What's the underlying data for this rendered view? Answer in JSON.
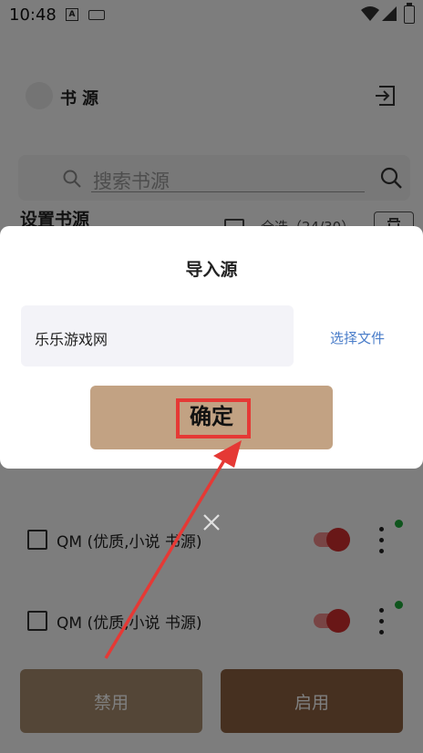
{
  "status_bar": {
    "time": "10:48",
    "notif_letter": "A"
  },
  "app_bar": {
    "title": "书源"
  },
  "search": {
    "placeholder": "搜索书源"
  },
  "section": {
    "title": "设置书源",
    "select_all_label": "全选（24/30）"
  },
  "sources": [
    {
      "name": "QM (优质,小说 书源)",
      "enabled": true,
      "status": "active"
    },
    {
      "name": "QM (优质,小说 书源)",
      "enabled": true,
      "status": "active"
    }
  ],
  "bottom": {
    "disable_label": "禁用",
    "enable_label": "启用"
  },
  "dialog": {
    "title": "导入源",
    "input_value": "乐乐游戏网",
    "choose_file_label": "选择文件",
    "confirm_label": "确定"
  },
  "colors": {
    "confirm_button": "#c2a283",
    "highlight_frame": "#e53935",
    "link_blue": "#4a7dc9",
    "toggle_on": "#d32f2f",
    "status_dot": "#1faa3a"
  }
}
